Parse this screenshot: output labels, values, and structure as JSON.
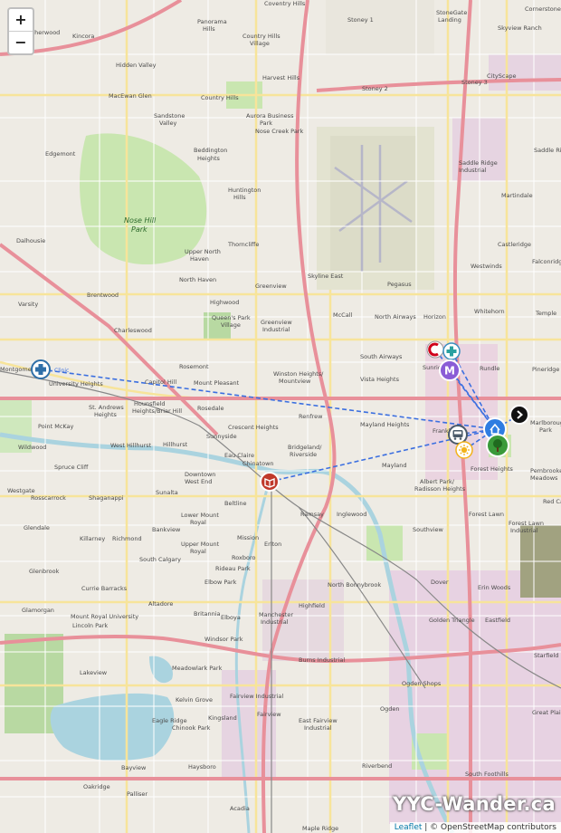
{
  "map": {
    "zoom_in": "+",
    "zoom_out": "−",
    "brand": "YYC-Wander.ca",
    "attribution": {
      "leaflet": "Leaflet",
      "separator": " | © ",
      "osm": "OpenStreetMap contributors"
    },
    "neighborhoods": [
      "Coventry Hills",
      "Panorama Hills",
      "Stoney 1",
      "StoneGate Landing",
      "Skyview Ranch",
      "Cornerstone",
      "Sherwood",
      "Kincora",
      "Country Hills Village",
      "Hidden Valley",
      "Harvest Hills",
      "Stoney 2",
      "Stoney 3",
      "MacEwan Glen",
      "Sandstone Valley",
      "Country Hills",
      "Aurora Business Park",
      "Nose Creek Park",
      "CityScape",
      "Edgemont",
      "Beddington Heights",
      "Saddle Ridge",
      "Saddle Ridge Industrial",
      "Huntington Hills",
      "Martindale",
      "Dalhousie",
      "Thorncliffe",
      "Upper North Haven",
      "Castleridge",
      "Westwinds",
      "Falconridge",
      "North Haven",
      "Skyline East",
      "Pegasus",
      "Brentwood",
      "Varsity",
      "Highwood",
      "Greenview",
      "McCall",
      "North Airways",
      "Horizon",
      "Whitehorn",
      "Temple",
      "Charleswood",
      "Queen's Park Village",
      "Greenview Industrial",
      "South Airways",
      "Sunridge",
      "Rundle",
      "Pineridge",
      "Rosemont",
      "Winston Heights/Mountview",
      "Vista Heights",
      "Montgomery",
      "University Heights",
      "Mount Pleasant",
      "Capitol Hill",
      "St. Andrews Heights",
      "Hounsfield Heights/Briar Hill",
      "Rosedale",
      "Renfrew",
      "Mayland Heights",
      "Franklin",
      "Marlborough Park",
      "Point McKay",
      "West Hillhurst",
      "Hillhurst",
      "Crescent Heights",
      "Bridgeland/Riverside",
      "Mayland",
      "Forest Heights",
      "Wildwood",
      "Spruce Cliff",
      "Sunnyside",
      "Eau Claire",
      "Chinatown",
      "Albert Park/Radisson Heights",
      "Pembrooke Meadows",
      "Westgate",
      "Rosscarrock",
      "Downtown West End",
      "Shaganappi",
      "Sunalta",
      "Beltline",
      "Red Carpet",
      "Ramsay",
      "Inglewood",
      "Forest Lawn",
      "Glendale",
      "Killarney",
      "Richmond",
      "Bankview",
      "Lower Mount Royal",
      "Upper Mount Royal",
      "Mission",
      "Erlton",
      "South Calgary",
      "Roxboro",
      "Rideau Park",
      "Southview",
      "Forest Lawn Industrial",
      "Glenbrook",
      "Elbow Park",
      "Dover",
      "Erin Woods",
      "Currie Barracks",
      "Altadore",
      "Highfield",
      "North Bonnybrook",
      "Glamorgan",
      "Mount Royal University",
      "Lincoln Park",
      "Britannia",
      "Elboya",
      "Manchester Industrial",
      "Golden Triangle",
      "Eastfield",
      "Windsor Park",
      "Starfield",
      "Lakeview",
      "Meadowlark Park",
      "Burns Industrial",
      "Ogden Shops",
      "Kelvin Grove",
      "Fairview Industrial",
      "Kingsland",
      "Eagle Ridge",
      "Chinook Park",
      "Fairview",
      "East Fairview Industrial",
      "Ogden",
      "Great Plains",
      "Bayview",
      "Haysboro",
      "Riverbend",
      "South Foothills",
      "Oakridge",
      "Palliser",
      "Acadia",
      "Maple Ridge",
      "Starfield"
    ],
    "parks": [
      "Nose Hill Park"
    ],
    "markers": [
      {
        "name": "clinic-marker-west",
        "icon": "medical-cross-icon",
        "color": "#2f6fa8",
        "label": "Clinic"
      },
      {
        "name": "canadian-tire-marker",
        "icon": "canadian-tire-icon",
        "color": "#d0021b"
      },
      {
        "name": "clinic-marker-east",
        "icon": "medical-cross-icon",
        "color": "#3a8fc0"
      },
      {
        "name": "mall-marker",
        "icon": "letter-m-icon",
        "color": "#8a5cd6",
        "label": "M"
      },
      {
        "name": "transit-marker",
        "icon": "bus-icon",
        "color": "#4a5a6a"
      },
      {
        "name": "home-marker",
        "icon": "home-icon",
        "color": "#2f7de1"
      },
      {
        "name": "next-marker",
        "icon": "chevron-right-icon",
        "color": "#111111"
      },
      {
        "name": "tree-marker",
        "icon": "tree-icon",
        "color": "#3a9a3a"
      },
      {
        "name": "sun-marker",
        "icon": "sun-icon",
        "color": "#f2b21b"
      },
      {
        "name": "library-marker",
        "icon": "library-icon",
        "color": "#c0392b"
      }
    ]
  }
}
